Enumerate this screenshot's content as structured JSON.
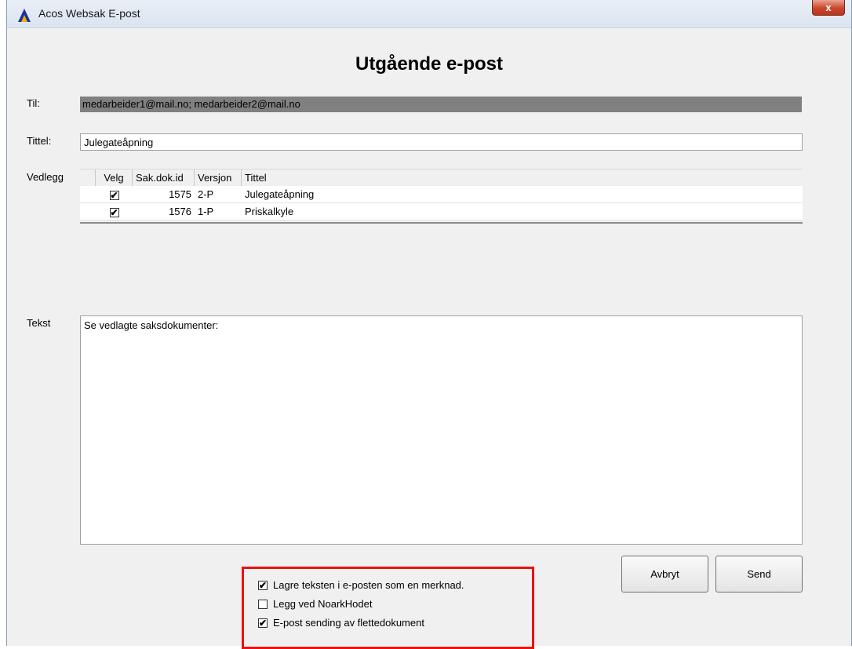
{
  "window": {
    "title": "Acos Websak E-post",
    "close_label": "x"
  },
  "heading": "Utgående e-post",
  "fields": {
    "til_label": "Til:",
    "til_value": "medarbeider1@mail.no; medarbeider2@mail.no",
    "tittel_label": "Tittel:",
    "tittel_value": "Julegateåpning",
    "vedlegg_label": "Vedlegg",
    "tekst_label": "Tekst",
    "tekst_value": "Se vedlagte saksdokumenter:"
  },
  "attachments": {
    "columns": [
      "Velg",
      "Sak.dok.id",
      "Versjon",
      "Tittel"
    ],
    "rows": [
      {
        "checked": true,
        "id": "1575",
        "version": "2-P",
        "title": "Julegateåpning"
      },
      {
        "checked": true,
        "id": "1576",
        "version": "1-P",
        "title": "Priskalkyle"
      }
    ]
  },
  "buttons": {
    "cancel": "Avbryt",
    "send": "Send"
  },
  "options": [
    {
      "label": "Lagre teksten i e-posten som en merknad.",
      "checked": true
    },
    {
      "label": "Legg ved NoarkHodet",
      "checked": false
    },
    {
      "label": "E-post sending av flettedokument",
      "checked": true
    }
  ],
  "colors": {
    "highlight": "#ee1010",
    "recipient_field_bg": "#808080"
  },
  "icons": {
    "app": "acos-logo-icon",
    "checkbox_checked": "checkmark-icon"
  }
}
